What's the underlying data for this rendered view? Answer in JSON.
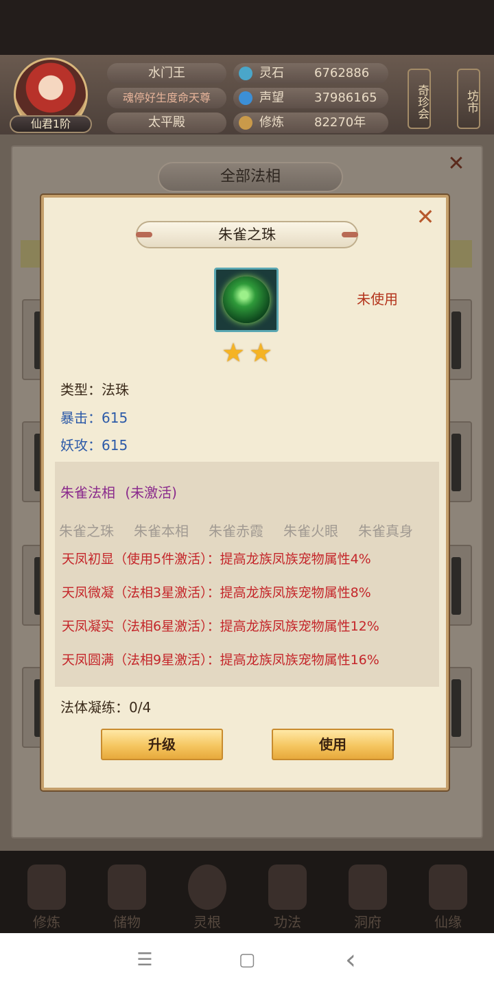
{
  "header": {
    "player_rank": "仙君1阶",
    "sect_name": "水门王",
    "title": "魂停好生度命天尊",
    "palace": "太平殿",
    "resources": [
      {
        "name": "灵石",
        "value": "6762886",
        "icon": "spirit-stone-icon",
        "color": "#4aa6c9"
      },
      {
        "name": "声望",
        "value": "37986165",
        "icon": "prestige-icon",
        "color": "#3c8fd6"
      },
      {
        "name": "修炼",
        "value": "82270年",
        "icon": "cultivation-icon",
        "color": "#c99a4a"
      }
    ],
    "side_buttons": [
      "奇珍会",
      "坊市"
    ]
  },
  "background_panel": {
    "title": "全部法相"
  },
  "popup": {
    "item_name": "朱雀之珠",
    "status": "未使用",
    "stars": 2,
    "type_label": "类型：",
    "type_value": "法珠",
    "attributes": [
      {
        "label": "暴击：",
        "value": "615"
      },
      {
        "label": "妖攻：",
        "value": "615"
      }
    ],
    "set_title": "朱雀法相",
    "set_state": "(未激活)",
    "set_members": [
      "朱雀之珠",
      "朱雀本相",
      "朱雀赤霞",
      "朱雀火眼",
      "朱雀真身"
    ],
    "set_effects": [
      "天凤初显（使用5件激活）：提高龙族凤族宠物属性4%",
      "天凤微凝（法相3星激活）：提高龙族凤族宠物属性8%",
      "天凤凝实（法相6星激活）：提高龙族凤族宠物属性12%",
      "天凤圆满（法相9星激活）：提高龙族凤族宠物属性16%"
    ],
    "refine_label": "法体凝练：",
    "refine_value": "0/4",
    "upgrade_button": "升级",
    "use_button": "使用"
  },
  "bottom_nav": [
    "修炼",
    "储物",
    "灵根",
    "功法",
    "洞府",
    "仙缘"
  ],
  "system_nav": {
    "menu_icon": "☰",
    "home_icon": "▢",
    "back_icon": "‹"
  },
  "colors": {
    "accent_red": "#c4262a",
    "set_purple": "#8a2a8c",
    "attr_blue": "#2c5aa8",
    "star_gold": "#f5b323"
  }
}
